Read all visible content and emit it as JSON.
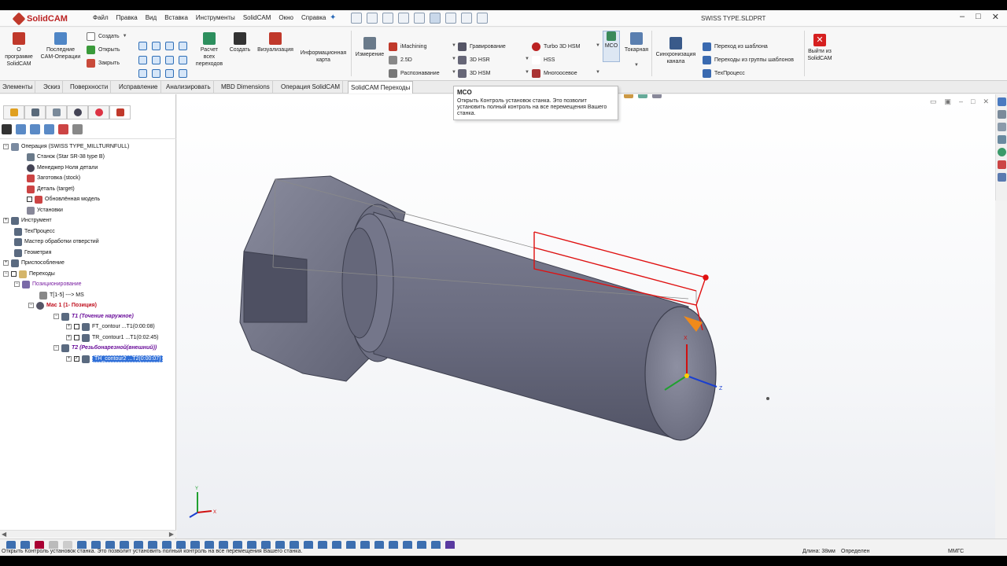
{
  "app": {
    "logo_text": "SolidCAM",
    "menu": [
      "Файл",
      "Правка",
      "Вид",
      "Вставка",
      "Инструменты",
      "SolidCAM",
      "Окно",
      "Справка"
    ],
    "document_title": "SWISS TYPE.SLDPRT",
    "window_controls": [
      "–",
      "□",
      "✕"
    ]
  },
  "ribbon": {
    "about": "О программе SolidCAM",
    "recent": "Последние CAM-Операции",
    "create": "Создать",
    "open": "Открыть",
    "close": "Закрыть",
    "calc_all": "Расчет всех переходов",
    "create2": "Создать",
    "visualization": "Визуализация",
    "info_card": "Информационная карта",
    "measure": "Измерение",
    "imachining": "iMachining",
    "d25": "2.5D",
    "recognition": "Распознавание",
    "engraving": "Гравирование",
    "hsr3d": "3D HSR",
    "hsm3d": "3D HSM",
    "turbo": "Turbo 3D HSM",
    "hss": "HSS",
    "multiaxis": "Многоосевое",
    "mco": "MCO",
    "turning": "Токарная",
    "sync": "Синхронизация канала",
    "from_template": "Переход из шаблона",
    "from_group": "Переходы из группы шаблонов",
    "techprocess": "ТехПроцесс",
    "exit": "Выйти из SolidCAM"
  },
  "tabs": [
    "Элементы",
    "Эскиз",
    "Поверхности",
    "Исправление",
    "Анализировать",
    "MBD Dimensions",
    "Операция SolidCAM",
    "SolidCAM Переходы"
  ],
  "active_tab": "SolidCAM Переходы",
  "tooltip": {
    "title": "MCO",
    "body": "Открыть Контроль установок станка. Это позволит установить полный контроль на все перемещения Вашего станка."
  },
  "tree": {
    "root": "Операция (SWISS TYPE_MILLTURNFULL)",
    "machine": "Станок (Star SR-38 type B)",
    "coord_manager": "Менеджер Ноля детали",
    "stock": "Заготовка (stock)",
    "target": "Деталь (target)",
    "updated_model": "Обновлённая модель",
    "setups": "Установки",
    "tool": "Инструмент",
    "techprocess": "ТехПроцесс",
    "hole_wizard": "Мастер обработки отверстий",
    "geometry": "Геометрия",
    "fixture": "Приспособление",
    "operations": "Переходы",
    "positioning": "Позиционирование",
    "t_range": "T[1-5] ---> MS",
    "mac1": "Mac 1 (1- Позиция)",
    "t1": "T1  (Точение наружное)",
    "ft_contour": "FT_contour ...T1(0:00:08)",
    "tr_contour": "TR_contour1 ...T1(0:02:45)",
    "t2": "T2  (Резьбонарезной(внешний))",
    "th_contour": "TH_contour2 ...T2(0:00:07)"
  },
  "status": {
    "message": "Открыть Контроль установок станка. Это позволит установить полный контроль на все перемещения Вашего станка.",
    "length": "Длина: 38мм",
    "defined": "Определен",
    "units": "MMГС"
  },
  "axes": {
    "x": "X",
    "y": "Y",
    "z": "Z"
  },
  "colors": {
    "accent": "#2f6fd8",
    "selection_edge": "#e01010",
    "part_body": "#6f7184"
  }
}
